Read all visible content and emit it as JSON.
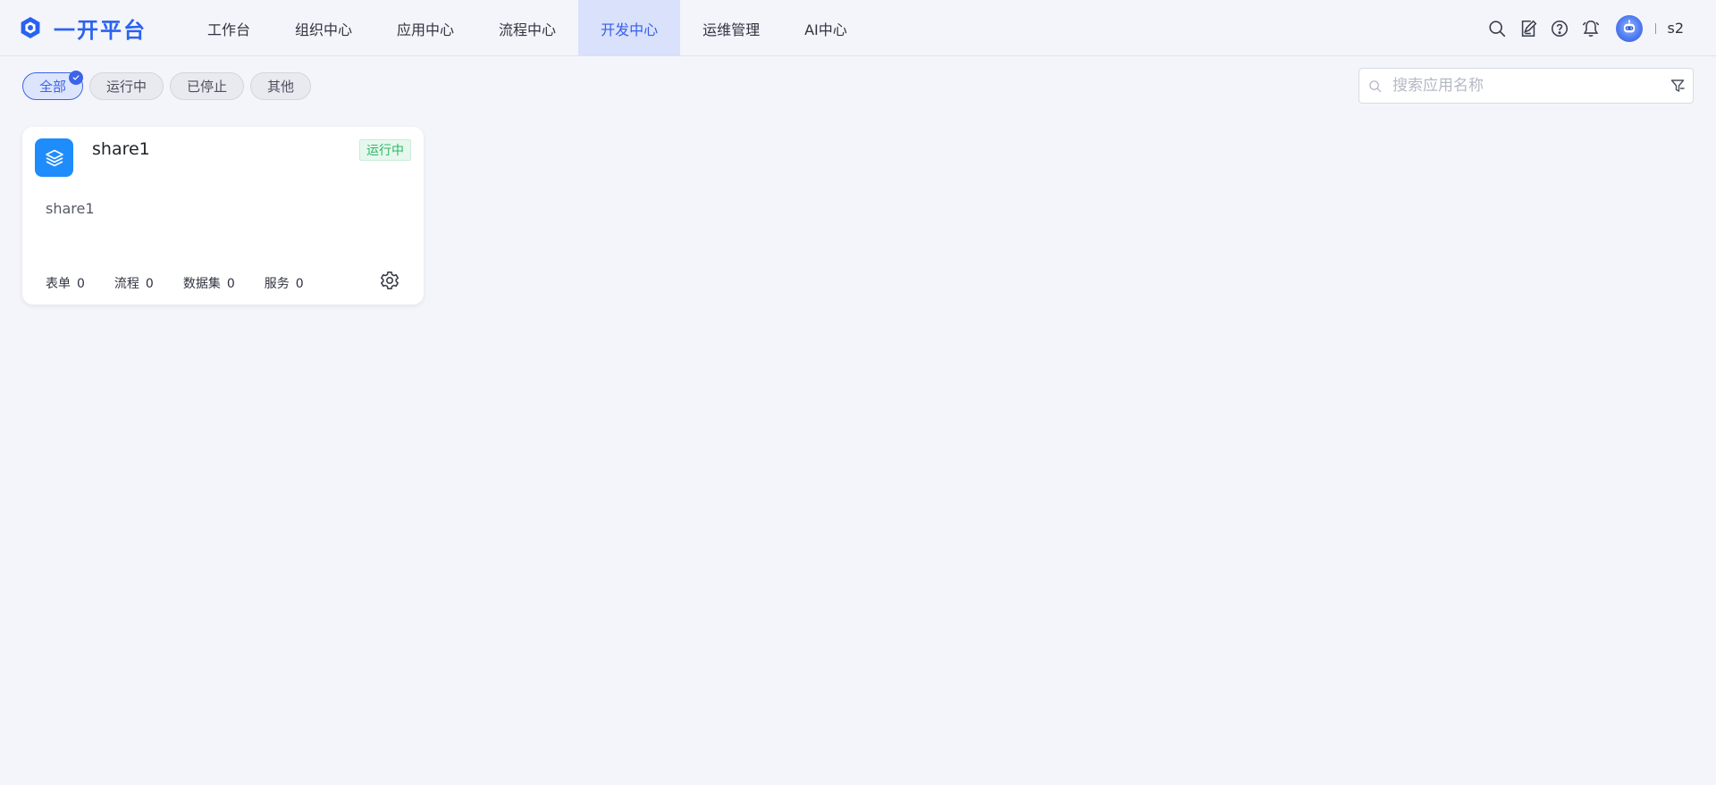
{
  "brand": {
    "name": "一开平台"
  },
  "nav": {
    "items": [
      {
        "label": "工作台",
        "active": false
      },
      {
        "label": "组织中心",
        "active": false
      },
      {
        "label": "应用中心",
        "active": false
      },
      {
        "label": "流程中心",
        "active": false
      },
      {
        "label": "开发中心",
        "active": true
      },
      {
        "label": "运维管理",
        "active": false
      },
      {
        "label": "AI中心",
        "active": false
      }
    ]
  },
  "header": {
    "icons": [
      "search-icon",
      "edit-icon",
      "help-icon",
      "bell-icon"
    ],
    "username": "s2"
  },
  "filters": {
    "chips": [
      {
        "label": "全部",
        "active": true
      },
      {
        "label": "运行中",
        "active": false
      },
      {
        "label": "已停止",
        "active": false
      },
      {
        "label": "其他",
        "active": false
      }
    ]
  },
  "search": {
    "placeholder": "搜索应用名称",
    "value": ""
  },
  "app_card": {
    "title": "share1",
    "status": "运行中",
    "description": "share1",
    "stats": [
      {
        "label": "表单",
        "value": "0"
      },
      {
        "label": "流程",
        "value": "0"
      },
      {
        "label": "数据集",
        "value": "0"
      },
      {
        "label": "服务",
        "value": "0"
      }
    ]
  },
  "colors": {
    "accent": "#3560ea",
    "brand": "#2a62f0",
    "status_running": "#2fb565",
    "app_icon": "#1f8cfb",
    "background": "#f4f5fa"
  }
}
